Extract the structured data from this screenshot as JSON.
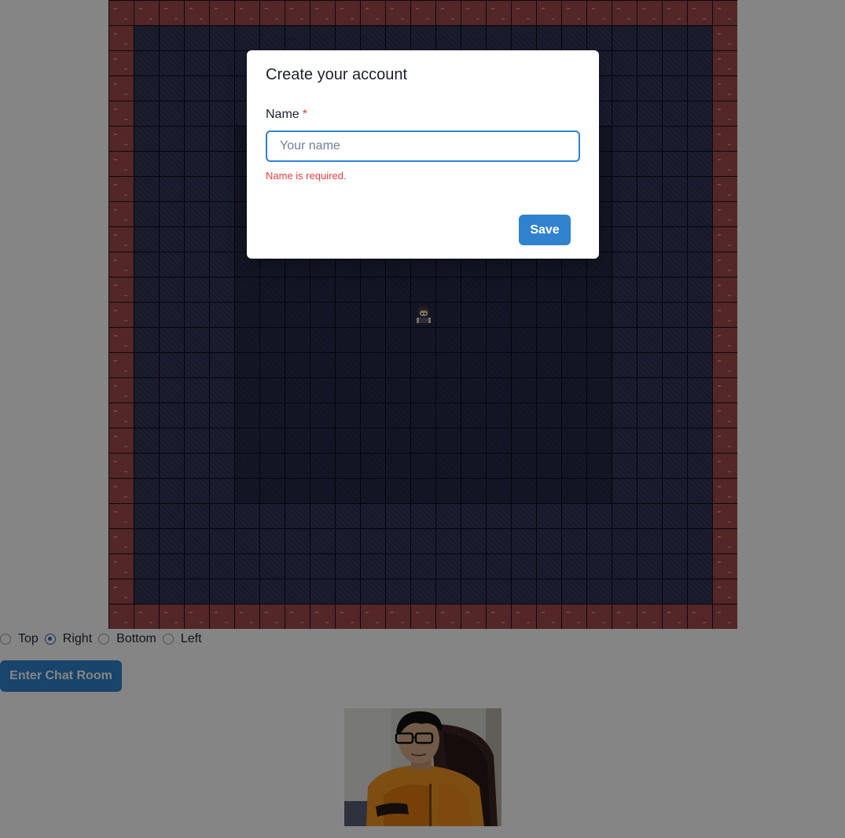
{
  "modal": {
    "title": "Create your account",
    "name_label": "Name",
    "required_mark": "*",
    "name_placeholder": "Your name",
    "name_value": "",
    "error_text": "Name is required.",
    "save_label": "Save"
  },
  "map_position": {
    "options": [
      "Top",
      "Right",
      "Bottom",
      "Left"
    ],
    "selected": "Right"
  },
  "enter_chat_label": "Enter Chat Room",
  "colors": {
    "accent": "#3182ce",
    "error": "#e53e3e",
    "wall": "#a04a4c",
    "floor": "#2e3153"
  },
  "icons": {
    "player_avatar": "player-sprite-icon",
    "webcam": "webcam-video-preview"
  }
}
